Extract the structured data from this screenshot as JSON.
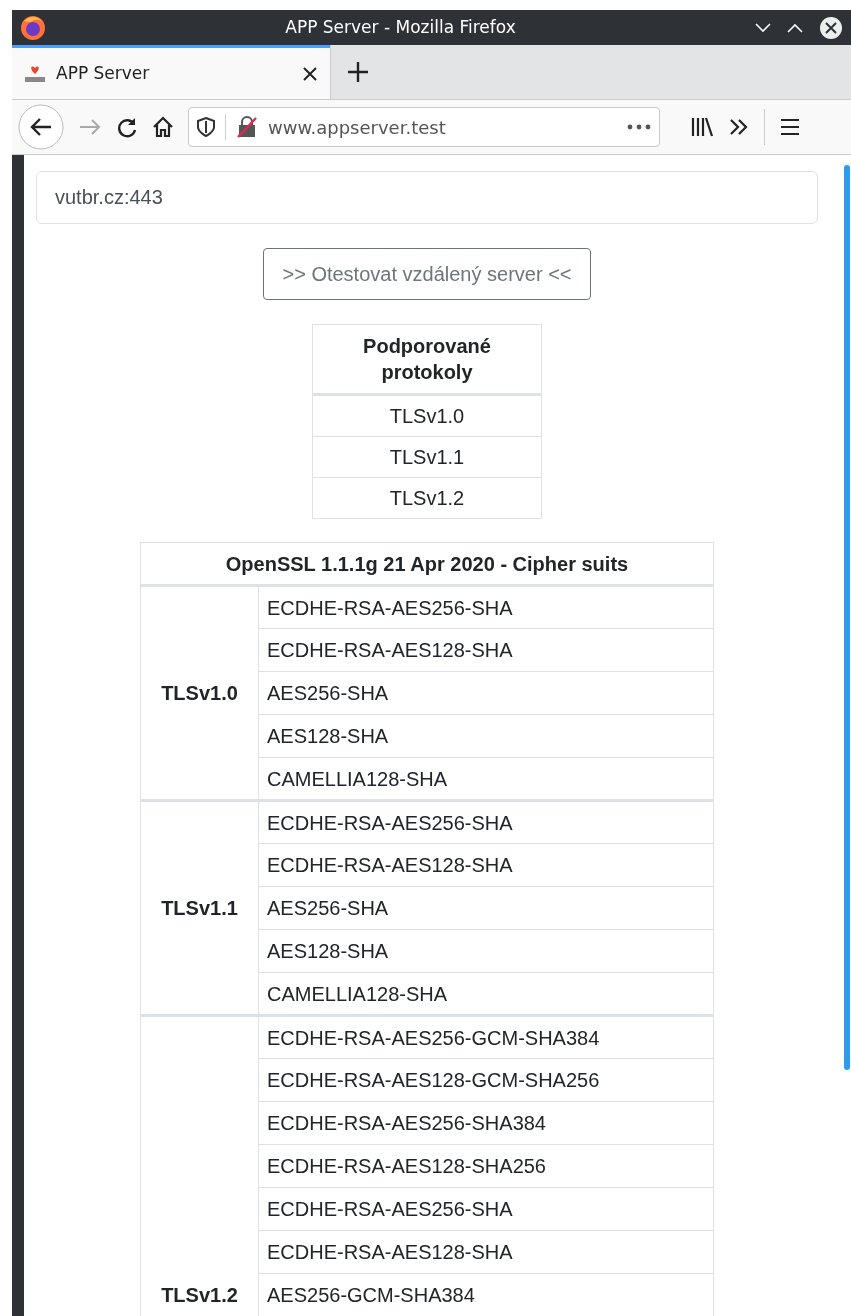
{
  "window": {
    "title": "APP Server - Mozilla Firefox"
  },
  "tabs": [
    {
      "label": "APP Server",
      "selected": true
    }
  ],
  "address_bar": {
    "url": "www.appserver.test"
  },
  "server_field": {
    "value": "vutbr.cz:443"
  },
  "test_button": {
    "label": ">> Otestovat vzdálený server <<"
  },
  "protocols_table": {
    "header": "Podporované protokoly",
    "rows": [
      "TLSv1.0",
      "TLSv1.1",
      "TLSv1.2"
    ]
  },
  "cipher_table": {
    "header": "OpenSSL 1.1.1g 21 Apr 2020 - Cipher suits",
    "groups": [
      {
        "protocol": "TLSv1.0",
        "ciphers": [
          "ECDHE-RSA-AES256-SHA",
          "ECDHE-RSA-AES128-SHA",
          "AES256-SHA",
          "AES128-SHA",
          "CAMELLIA128-SHA"
        ]
      },
      {
        "protocol": "TLSv1.1",
        "ciphers": [
          "ECDHE-RSA-AES256-SHA",
          "ECDHE-RSA-AES128-SHA",
          "AES256-SHA",
          "AES128-SHA",
          "CAMELLIA128-SHA"
        ]
      },
      {
        "protocol": "TLSv1.2",
        "ciphers": [
          "ECDHE-RSA-AES256-GCM-SHA384",
          "ECDHE-RSA-AES128-GCM-SHA256",
          "ECDHE-RSA-AES256-SHA384",
          "ECDHE-RSA-AES128-SHA256",
          "ECDHE-RSA-AES256-SHA",
          "ECDHE-RSA-AES128-SHA",
          "AES256-GCM-SHA384"
        ]
      }
    ]
  }
}
